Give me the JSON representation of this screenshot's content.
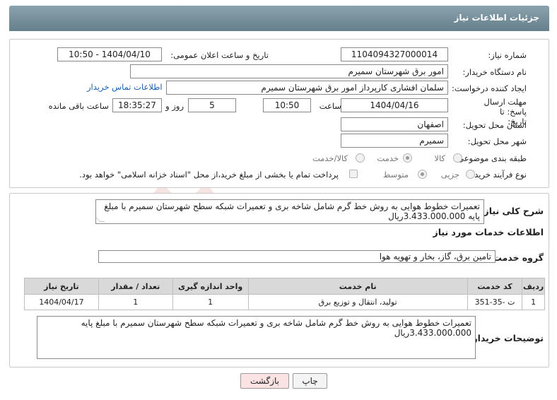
{
  "header": {
    "title": "جزئیات اطلاعات نیاز"
  },
  "form": {
    "need_number_label": "شماره نیاز:",
    "need_number": "1104094327000014",
    "announce_label": "تاریخ و ساعت اعلان عمومی:",
    "announce_value": "1404/04/10 - 10:50",
    "buyer_label": "نام دستگاه خریدار:",
    "buyer_value": "امور برق شهرستان سمیرم",
    "requester_label": "ایجاد کننده درخواست:",
    "requester_value": "سلمان  افشاری کارپرداز امور برق شهرستان سمیرم",
    "contact_link": "اطلاعات تماس خریدار",
    "deadline_label": "مهلت ارسال پاسخ: تا تاریخ:",
    "deadline_date": "1404/04/16",
    "hour_label": "ساعت",
    "deadline_time": "10:50",
    "days_value": "5",
    "days_label": "روز و",
    "remaining_time": "18:35:27",
    "remaining_label": "ساعت باقی مانده",
    "province_label": "استان محل تحویل:",
    "province_value": "اصفهان",
    "city_label": "شهر محل تحویل:",
    "city_value": "سمیرم",
    "category_label": "طبقه بندی موضوعی:",
    "category_options": [
      "کالا",
      "خدمت",
      "کالا/خدمت"
    ],
    "category_selected": "خدمت",
    "process_label": "نوع فرآیند خرید :",
    "process_options": [
      "جزیی",
      "متوسط"
    ],
    "process_selected": "متوسط",
    "payment_note": "پرداخت تمام یا بخشی از مبلغ خرید،از محل \"اسناد خزانه اسلامی\" خواهد بود."
  },
  "summary": {
    "label": "شرح کلی نیاز:",
    "text": "تعمیرات خطوط هوایی به روش خط گرم شامل شاخه بری و تعمیرات شبکه سطح شهرستان سمیرم با مبلغ پایه 3.433.000.000ریال"
  },
  "services": {
    "section_title": "اطلاعات خدمات مورد نیاز",
    "group_label": "گروه خدمت:",
    "group_value": "تامین برق، گاز، بخار و تهویه هوا",
    "columns": [
      "ردیف",
      "کد خدمت",
      "نام خدمت",
      "واحد اندازه گیری",
      "تعداد / مقدار",
      "تاریخ نیاز"
    ],
    "rows": [
      [
        "1",
        "ت -35-351",
        "تولید، انتقال و توزیع برق",
        "1",
        "1",
        "1404/04/17"
      ]
    ]
  },
  "buyer_notes": {
    "label": "توضیحات خریدار:",
    "text": "تعمیرات خطوط هوایی به روش خط گرم شامل شاخه بری و تعمیرات شبکه سطح شهرستان سمیرم با مبلغ پایه 3.433.000.000ریال"
  },
  "buttons": {
    "print": "چاپ",
    "back": "بازگشت"
  },
  "watermark": {
    "text": "AriaTender.net"
  },
  "colors": {
    "header": "#6f8893",
    "link": "#1a5fb4",
    "back_button": "#fbe3e3"
  }
}
